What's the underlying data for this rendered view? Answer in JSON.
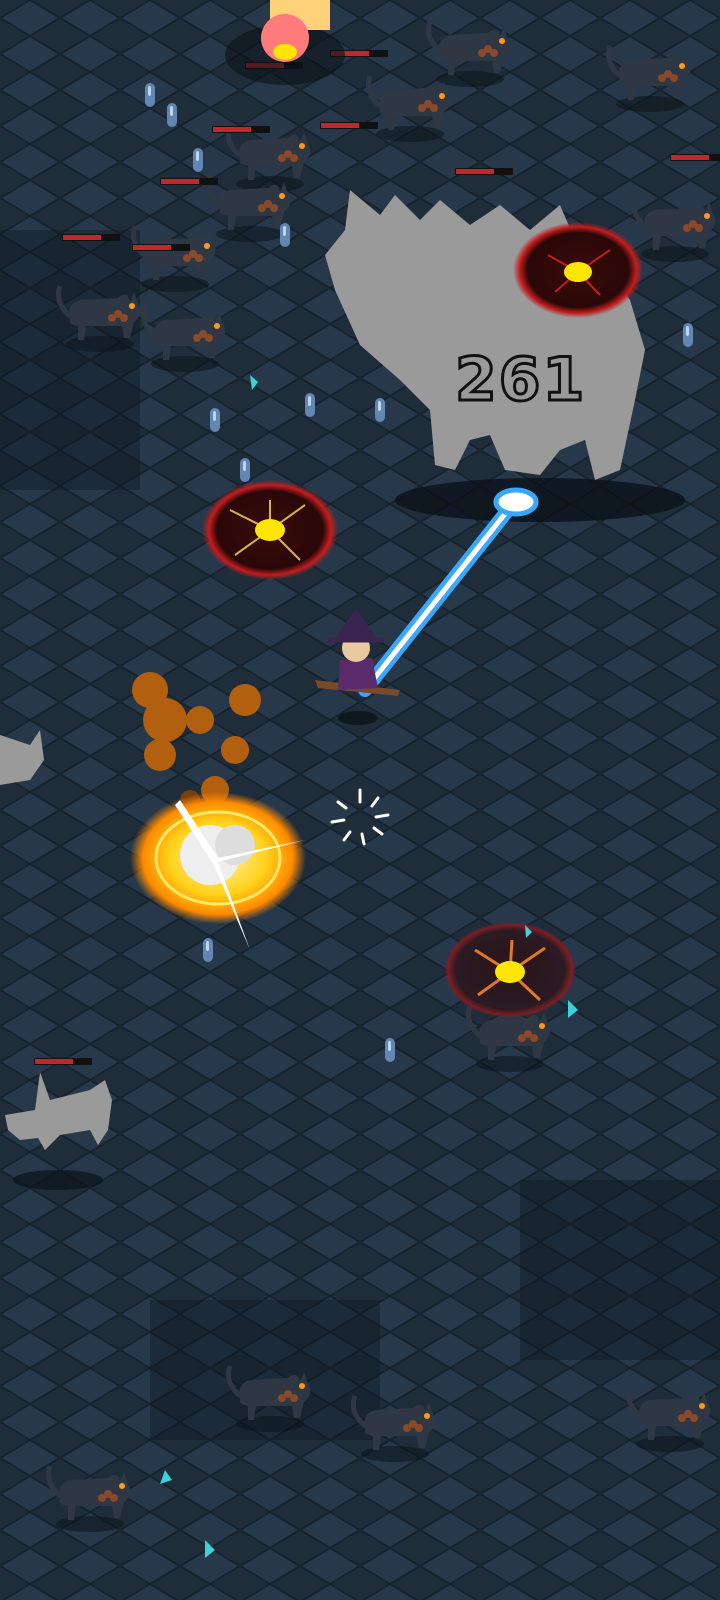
{
  "game": {
    "damage_number": "261"
  },
  "colors": {
    "floor": "#1f2d3a",
    "tile_light": "#2b3d4e",
    "tile_dark": "#15202b",
    "hp_bar": "#c1272d",
    "laser": "#3aa7ff",
    "rift_red": "#c21d1d",
    "explosion_gold": "#ffbf1a",
    "ghost_gray": "#9a9a9a"
  },
  "entities": {
    "player": "witch-on-broom",
    "enemy": "black-cat",
    "elite_enemy": "giant-ghost-cat",
    "pickup": "blue-experience-crystal",
    "hazard": "red-void-rift",
    "effect": "golden-explosion"
  }
}
